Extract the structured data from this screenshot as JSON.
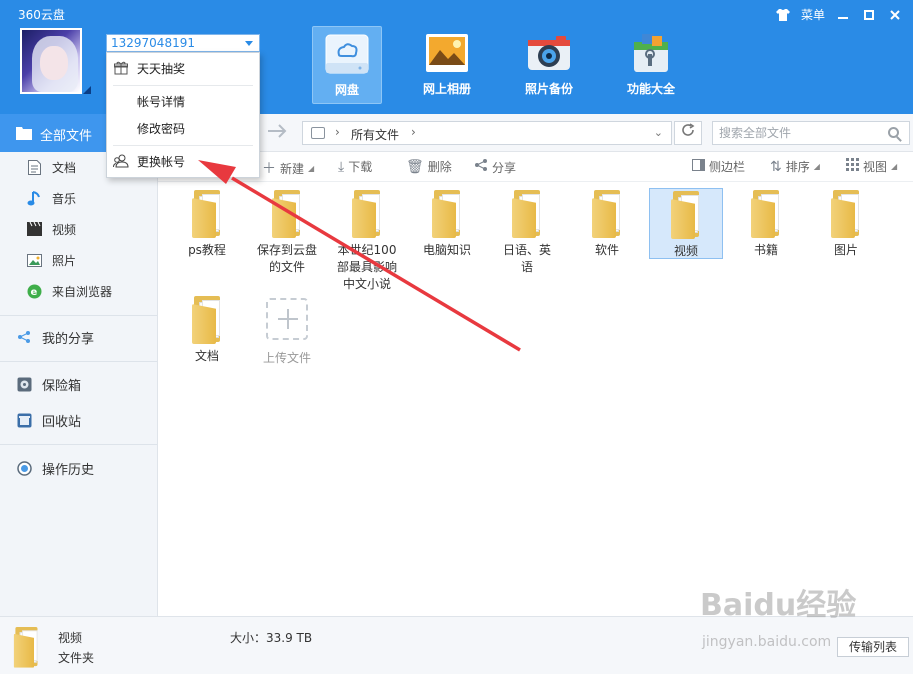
{
  "app": {
    "title": "360云盘"
  },
  "window": {
    "menu_label": "菜单"
  },
  "account": {
    "number": "13297048191"
  },
  "nav_tabs": [
    {
      "label": "网盘",
      "active": true
    },
    {
      "label": "网上相册"
    },
    {
      "label": "照片备份"
    },
    {
      "label": "功能大全"
    }
  ],
  "dropdown": {
    "items": [
      {
        "label": "天天抽奖"
      },
      {
        "label": "帐号详情"
      },
      {
        "label": "修改密码"
      },
      {
        "label": "更换帐号"
      }
    ]
  },
  "sidebar": {
    "all_files": "全部文件",
    "items": [
      {
        "label": "文档"
      },
      {
        "label": "音乐"
      },
      {
        "label": "视频"
      },
      {
        "label": "照片"
      },
      {
        "label": "来自浏览器"
      }
    ],
    "my_share": "我的分享",
    "safe": "保险箱",
    "recycle": "回收站",
    "history": "操作历史"
  },
  "breadcrumb": {
    "path": "所有文件"
  },
  "search": {
    "placeholder": "搜索全部文件"
  },
  "actions": {
    "new": "新建",
    "download": "下载",
    "delete": "删除",
    "share": "分享",
    "side_panel": "侧边栏",
    "sort": "排序",
    "view": "视图"
  },
  "files": [
    {
      "name": "ps教程"
    },
    {
      "name": "保存到云盘的文件"
    },
    {
      "name": "本世纪100部最具影响中文小说"
    },
    {
      "name": "电脑知识"
    },
    {
      "name": "日语、英语"
    },
    {
      "name": "软件"
    },
    {
      "name": "视频",
      "selected": true
    },
    {
      "name": "书籍"
    },
    {
      "name": "图片"
    },
    {
      "name": "文档"
    }
  ],
  "upload": {
    "label": "上传文件"
  },
  "status": {
    "name": "视频",
    "type": "文件夹",
    "size": "大小：33.9 TB",
    "transfer": "传输列表"
  },
  "watermark": {
    "brand": "Baidu经验",
    "url": "jingyan.baidu.com"
  },
  "colors": {
    "header": "#2a8be6",
    "accent": "#3e96ee",
    "arrow": "#e8393f"
  }
}
